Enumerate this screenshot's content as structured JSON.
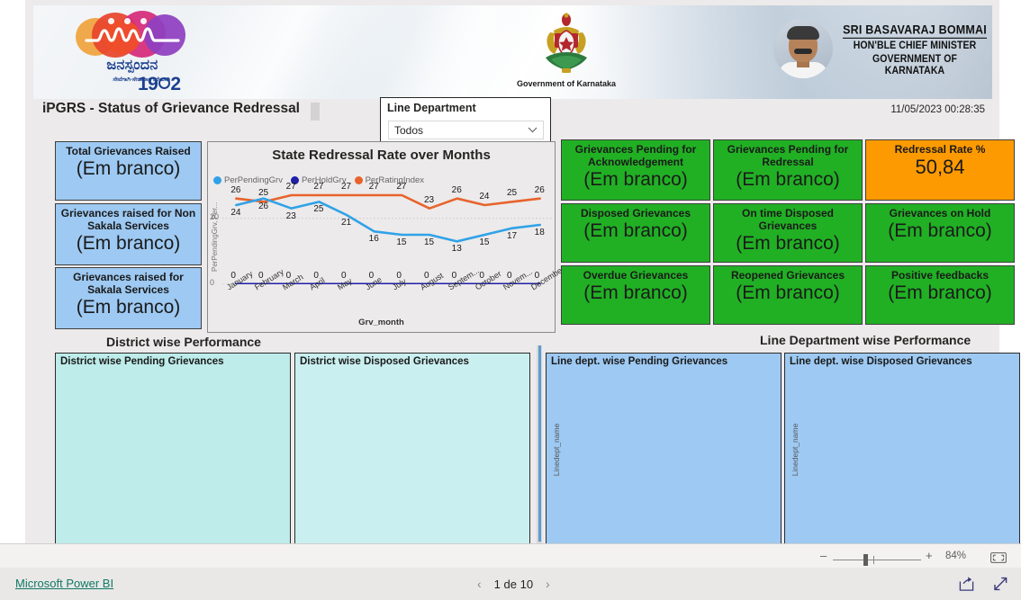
{
  "banner": {
    "logo": {
      "kannada_name": "ಜನಸ್ಪಂದನ",
      "kannada_tagline": "ಸೇವೆಗಾಗಿ-ಸೇರುವಾಗ ಕರೆಮಾಡಿ",
      "helpline_prefix": "19",
      "helpline_suffix": "2"
    },
    "emblem_caption": "Government of Karnataka",
    "cm_name": "SRI BASAVARAJ BOMMAI",
    "cm_designation": "HON'BLE CHIEF MINISTER",
    "cm_government": "GOVERNMENT OF KARNATAKA"
  },
  "header": {
    "page_title": "iPGRS - Status of Grievance Redressal",
    "timestamp": "11/05/2023 00:28:35"
  },
  "slicer": {
    "title": "Line Department",
    "selected_value": "Todos",
    "icon": "chevron-down-icon"
  },
  "kpis": {
    "blank_value": "(Em branco)",
    "left": [
      {
        "title": "Total Grievances Raised",
        "value": "(Em branco)",
        "color": "#9dc9f2"
      },
      {
        "title": "Grievances raised for Non Sakala Services",
        "value": "(Em branco)",
        "color": "#9dc9f2"
      },
      {
        "title": "Grievances raised for Sakala Services",
        "value": "(Em branco)",
        "color": "#9dc9f2"
      }
    ],
    "grid": [
      {
        "title": "Grievances Pending for Acknowledgement",
        "value": "(Em branco)",
        "color": "#21b024"
      },
      {
        "title": "Grievances Pending for Redressal",
        "value": "(Em branco)",
        "color": "#21b024"
      },
      {
        "title": "Redressal Rate %",
        "value": "50,84",
        "color": "#fd9a01"
      },
      {
        "title": "Disposed Grievances",
        "value": "(Em branco)",
        "color": "#21b024"
      },
      {
        "title": "On time Disposed Grievances",
        "value": "(Em branco)",
        "color": "#21b024"
      },
      {
        "title": "Grievances on Hold",
        "value": "(Em branco)",
        "color": "#21b024"
      },
      {
        "title": "Overdue Grievances",
        "value": "(Em branco)",
        "color": "#21b024"
      },
      {
        "title": "Reopened Grievances",
        "value": "(Em branco)",
        "color": "#21b024"
      },
      {
        "title": "Positive feedbacks",
        "value": "(Em branco)",
        "color": "#21b024"
      }
    ]
  },
  "chart_data": {
    "type": "line",
    "title": "State Redressal Rate over Months",
    "xlabel": "Grv_month",
    "ylabel": "PerPendingGrv, Per...",
    "categories": [
      "January",
      "February",
      "March",
      "April",
      "May",
      "June",
      "July",
      "August",
      "Septem...",
      "October",
      "Novem...",
      "December"
    ],
    "ylim": [
      0,
      30
    ],
    "yticks": [
      0,
      20
    ],
    "grid": true,
    "legend_position": "top-left",
    "series": [
      {
        "name": "PerPendingGrv",
        "color": "#30a2e8",
        "values": [
          24,
          26,
          23,
          25,
          21,
          16,
          15,
          15,
          13,
          15,
          17,
          18
        ]
      },
      {
        "name": "PerHoldGrv",
        "color": "#1f1fa8",
        "values": [
          0,
          0,
          0,
          0,
          0,
          0,
          0,
          0,
          0,
          0,
          0,
          0
        ]
      },
      {
        "name": "PerRatingIndex",
        "color": "#e8632c",
        "values": [
          26,
          25,
          27,
          27,
          27,
          27,
          27,
          23,
          26,
          24,
          25,
          26
        ]
      }
    ]
  },
  "sections": {
    "district_header": "District wise Performance",
    "linedept_header": "Line Department wise Performance"
  },
  "panels": [
    {
      "title": "District wise Pending Grievances",
      "axis_label": "",
      "color": "#bdecea"
    },
    {
      "title": "District wise Disposed Grievances",
      "axis_label": "",
      "color": "#caeff0"
    },
    {
      "title": "Line dept. wise Pending Grievances",
      "axis_label": "Linedept_name",
      "color": "#9dc9f2"
    },
    {
      "title": "Line dept. wise Disposed Grievances",
      "axis_label": "Linedept_name",
      "color": "#9dc9f2"
    }
  ],
  "zoombar": {
    "minus": "–",
    "plus": "+",
    "percent": "84%",
    "fit_icon": "fit-to-page-icon"
  },
  "footer": {
    "brand_link": "Microsoft Power BI",
    "prev_icon": "chevron-left-icon",
    "next_icon": "chevron-right-icon",
    "page_indicator": "1 de 10",
    "share_icon": "share-icon",
    "expand_icon": "expand-icon"
  }
}
